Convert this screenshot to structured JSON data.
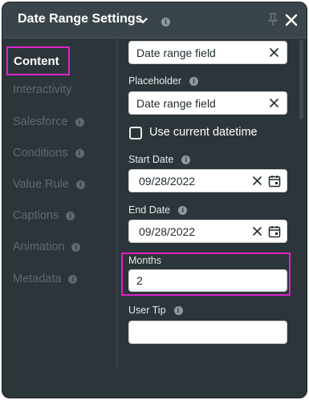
{
  "header": {
    "title": "Date Range Settings",
    "info_icon": "i"
  },
  "sidebar": {
    "items": [
      {
        "label": "Content",
        "active": true,
        "has_info": false
      },
      {
        "label": "Interactivity",
        "active": false,
        "has_info": false
      },
      {
        "label": "Salesforce",
        "active": false,
        "has_info": true
      },
      {
        "label": "Conditions",
        "active": false,
        "has_info": true
      },
      {
        "label": "Value Rule",
        "active": false,
        "has_info": true
      },
      {
        "label": "Captions",
        "active": false,
        "has_info": true
      },
      {
        "label": "Animation",
        "active": false,
        "has_info": true
      },
      {
        "label": "Metadata",
        "active": false,
        "has_info": true
      }
    ]
  },
  "form": {
    "top_field_value": "Date range field",
    "placeholder_label": "Placeholder",
    "placeholder_value": "Date range field",
    "use_current_datetime_label": "Use current datetime",
    "use_current_datetime_checked": false,
    "start_date_label": "Start Date",
    "start_date_value": "09/28/2022",
    "end_date_label": "End Date",
    "end_date_value": "09/28/2022",
    "months_label": "Months",
    "months_value": "2",
    "user_tip_label": "User Tip",
    "user_tip_value": ""
  },
  "icons": {
    "title_chevron": "chevron-down-icon",
    "pin": "pin-icon",
    "close": "close-icon",
    "info": "info-icon",
    "clear": "clear-x-icon",
    "calendar": "calendar-icon"
  },
  "colors": {
    "panel_bg": "#2c353a",
    "header_bg": "#3a454b",
    "highlight": "#e022c6",
    "nav_inactive": "#5f6a6f",
    "text": "#ffffff"
  }
}
